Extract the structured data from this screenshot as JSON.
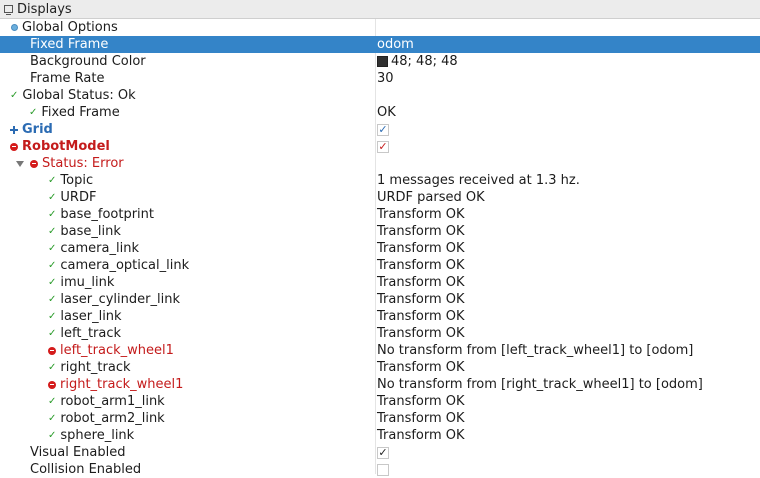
{
  "panel": {
    "title": "Displays"
  },
  "rows": {
    "global_options": {
      "label": "Global Options"
    },
    "fixed_frame": {
      "label": "Fixed Frame",
      "value": "odom"
    },
    "background_color": {
      "label": "Background Color",
      "value": "48; 48; 48",
      "color": "#303030"
    },
    "frame_rate": {
      "label": "Frame Rate",
      "value": "30"
    },
    "global_status": {
      "label": "Global Status: Ok"
    },
    "gs_fixed_frame": {
      "label": "Fixed Frame",
      "value": "OK"
    },
    "grid": {
      "label": "Grid",
      "checked": true
    },
    "robot_model": {
      "label": "RobotModel",
      "checked": true
    },
    "status_error": {
      "label": "Status: Error"
    },
    "topic": {
      "label": "Topic",
      "value": "1 messages received at 1.3 hz."
    },
    "urdf": {
      "label": "URDF",
      "value": "URDF parsed OK"
    },
    "links": [
      {
        "label": "base_footprint",
        "value": "Transform OK",
        "status": "ok"
      },
      {
        "label": "base_link",
        "value": "Transform OK",
        "status": "ok"
      },
      {
        "label": "camera_link",
        "value": "Transform OK",
        "status": "ok"
      },
      {
        "label": "camera_optical_link",
        "value": "Transform OK",
        "status": "ok"
      },
      {
        "label": "imu_link",
        "value": "Transform OK",
        "status": "ok"
      },
      {
        "label": "laser_cylinder_link",
        "value": "Transform OK",
        "status": "ok"
      },
      {
        "label": "laser_link",
        "value": "Transform OK",
        "status": "ok"
      },
      {
        "label": "left_track",
        "value": "Transform OK",
        "status": "ok"
      },
      {
        "label": "left_track_wheel1",
        "value": "No transform from [left_track_wheel1] to [odom]",
        "status": "error"
      },
      {
        "label": "right_track",
        "value": "Transform OK",
        "status": "ok"
      },
      {
        "label": "right_track_wheel1",
        "value": "No transform from [right_track_wheel1] to [odom]",
        "status": "error"
      },
      {
        "label": "robot_arm1_link",
        "value": "Transform OK",
        "status": "ok"
      },
      {
        "label": "robot_arm2_link",
        "value": "Transform OK",
        "status": "ok"
      },
      {
        "label": "sphere_link",
        "value": "Transform OK",
        "status": "ok"
      }
    ],
    "visual_enabled": {
      "label": "Visual Enabled",
      "checked": true
    },
    "collision_enabled": {
      "label": "Collision Enabled",
      "checked": false
    }
  },
  "colors": {
    "selection": "#3484c8",
    "error": "#c41b1b",
    "ok": "#2c9c2c",
    "grid": "#2b6bb3"
  },
  "icons": {
    "ok": "check-icon",
    "error": "error-circle-icon",
    "grid": "grid-icon",
    "global": "global-options-icon"
  }
}
